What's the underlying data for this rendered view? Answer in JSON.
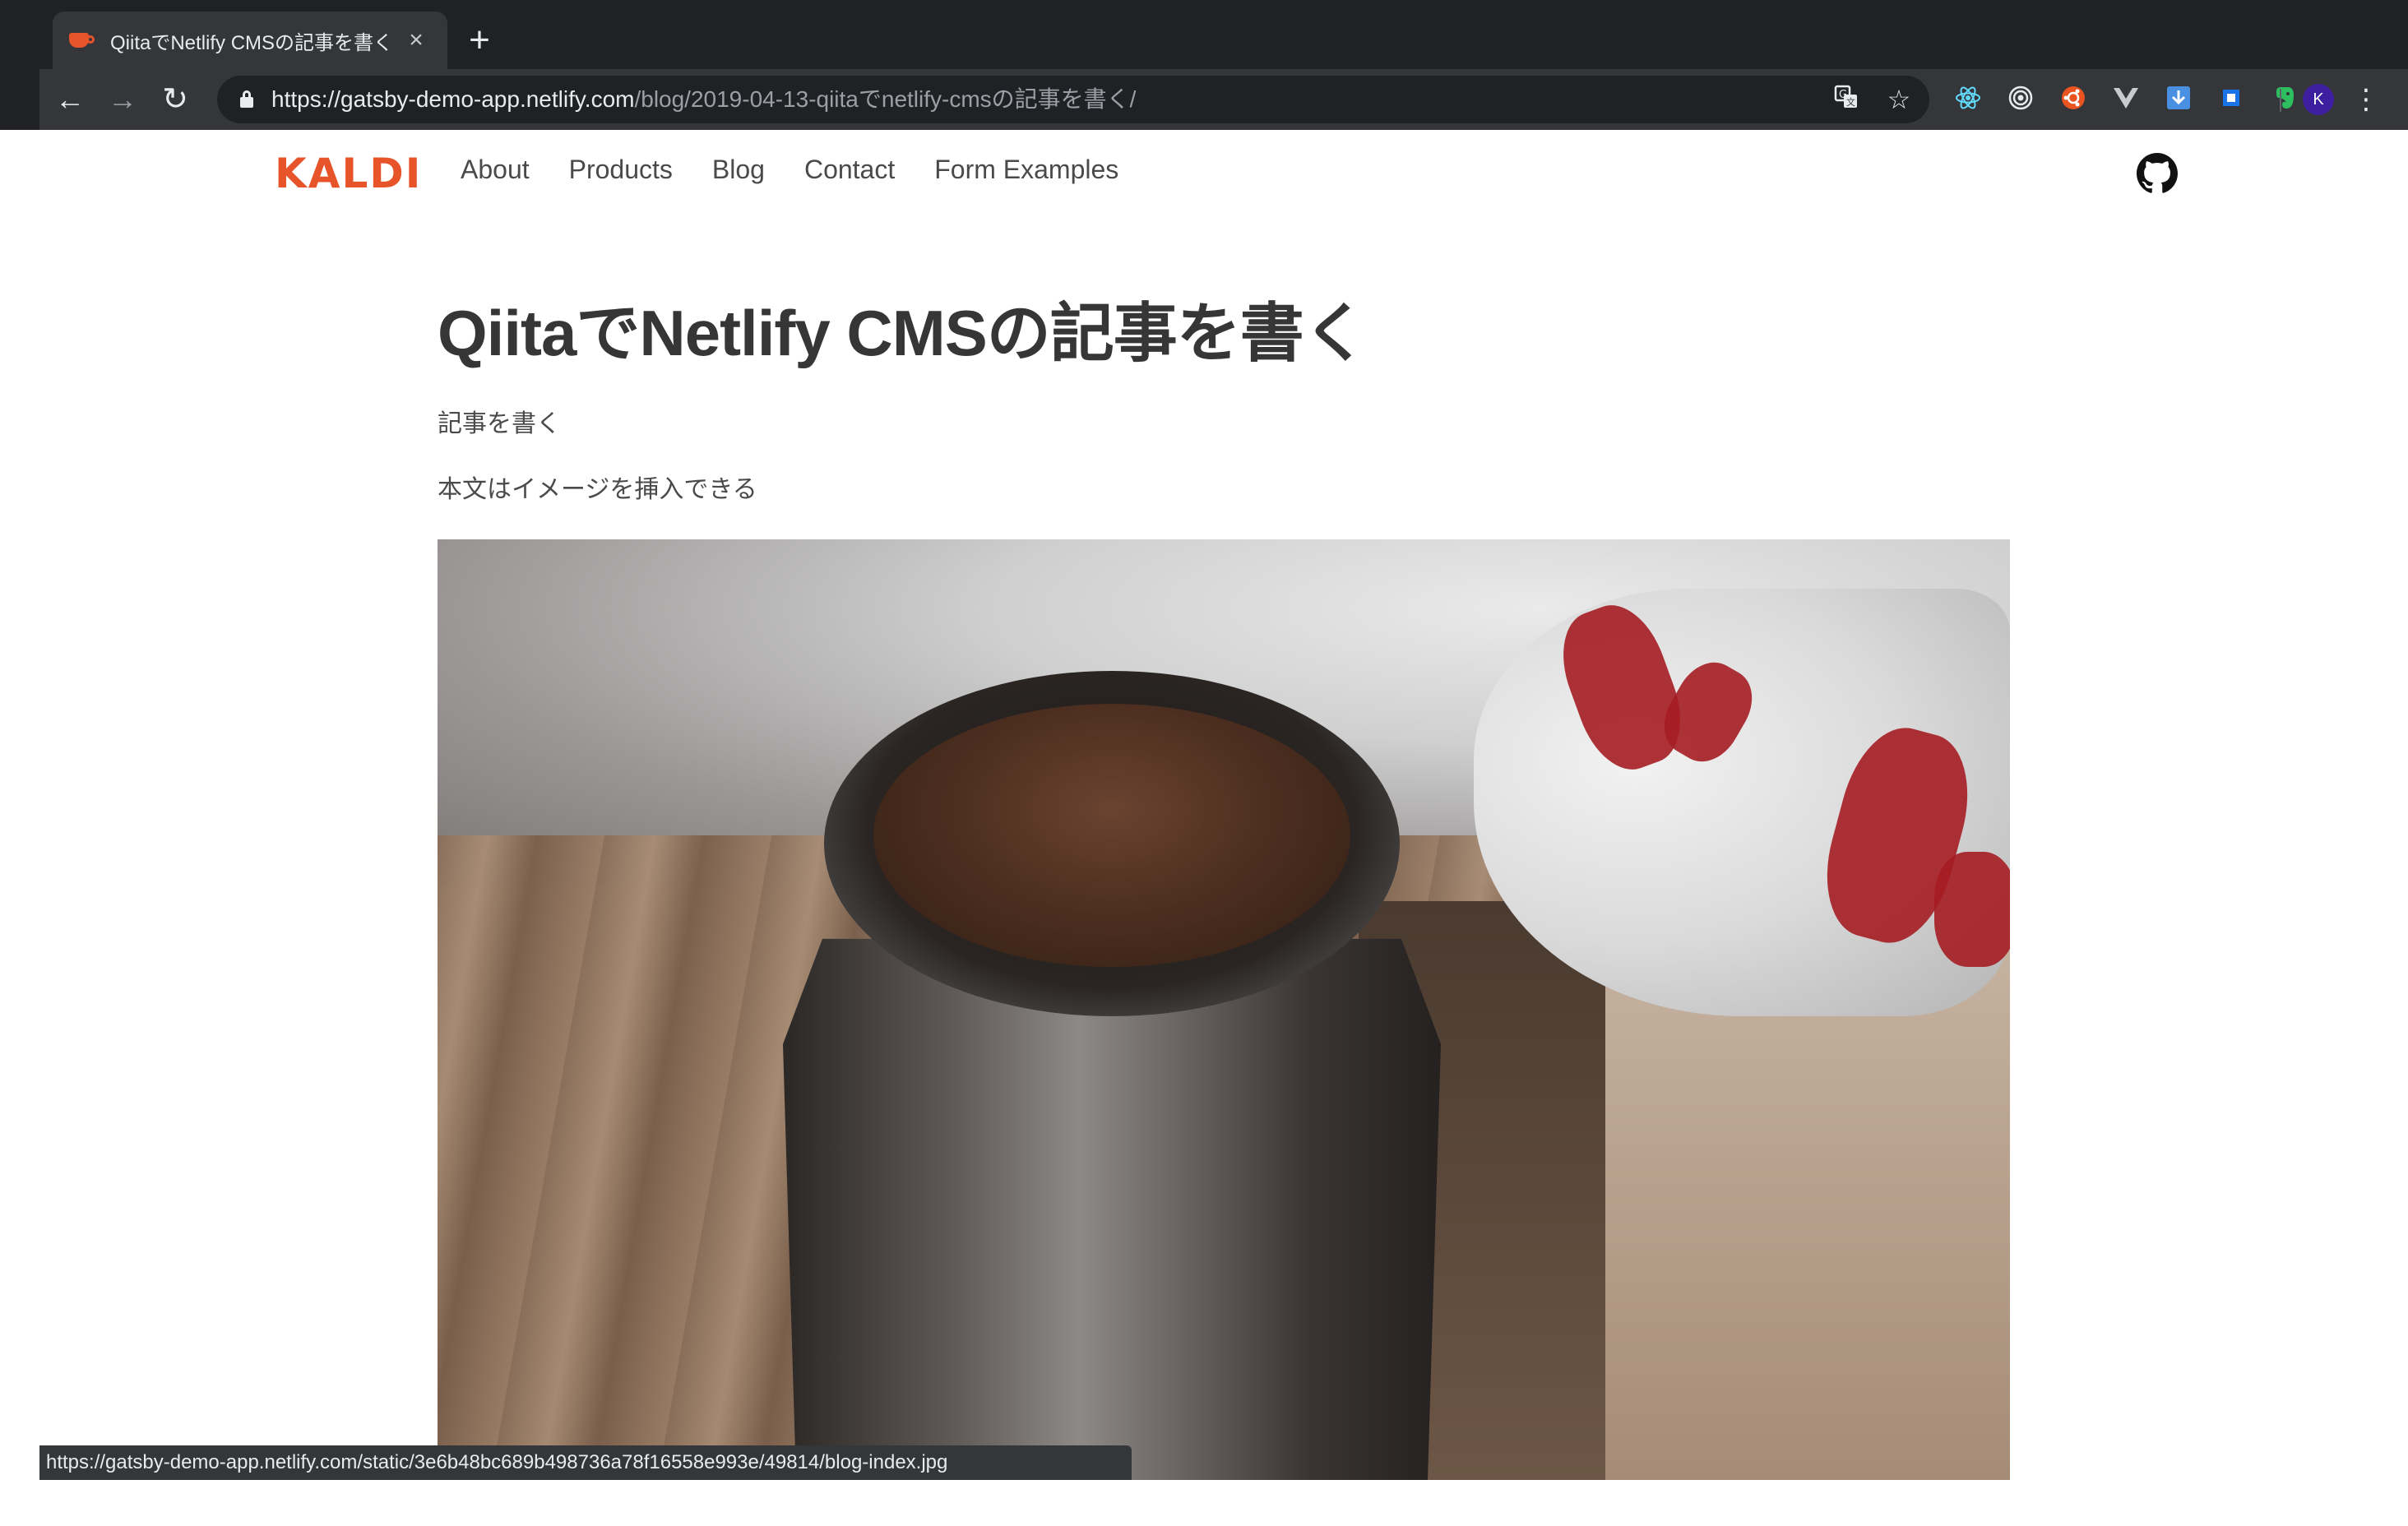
{
  "browser": {
    "tab": {
      "title": "QiitaでNetlify CMSの記事を書く",
      "close_glyph": "×",
      "favicon": "coffee-cup-icon"
    },
    "new_tab_glyph": "+",
    "nav": {
      "back_glyph": "←",
      "forward_glyph": "→",
      "reload_glyph": "↻"
    },
    "address": {
      "host": "https://gatsby-demo-app.netlify.com",
      "path": "/blog/2019-04-13-qiitaでnetlify-cmsの記事を書く/"
    },
    "omnibox_icons": [
      "translate-icon",
      "bookmark-star-icon"
    ],
    "extensions": [
      "react-devtools-icon",
      "target-icon",
      "ubuntu-icon",
      "vue-devtools-icon",
      "download-icon",
      "square-ext-icon",
      "evernote-icon"
    ],
    "profile_initial": "K",
    "menu_glyph": "⋮",
    "status_url": "https://gatsby-demo-app.netlify.com/static/3e6b48bc689b498736a78f16558e993e/49814/blog-index.jpg"
  },
  "site": {
    "brand": "KALDI",
    "brand_color": "#e8542a",
    "nav_links": [
      "About",
      "Products",
      "Blog",
      "Contact",
      "Form Examples"
    ],
    "github_icon": "github-icon"
  },
  "article": {
    "title": "QiitaでNetlify CMSの記事を書く",
    "description": "記事を書く",
    "body": "本文はイメージを挿入できる",
    "image": "coffee-moka-pot-photo"
  }
}
